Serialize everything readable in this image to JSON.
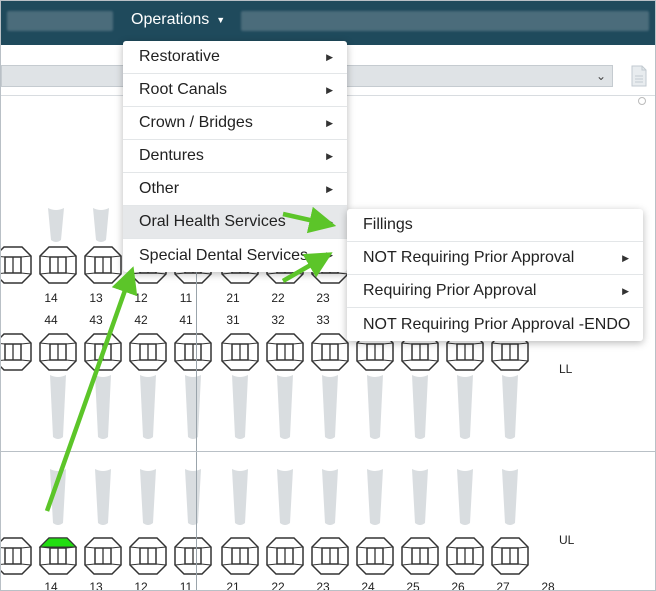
{
  "header": {
    "menu_label": "Operations",
    "menu_caret": "▼"
  },
  "dropdown": {
    "items": [
      {
        "label": "Restorative",
        "arrow": "▶"
      },
      {
        "label": "Root Canals",
        "arrow": "▶"
      },
      {
        "label": "Crown / Bridges",
        "arrow": "▶"
      },
      {
        "label": "Dentures",
        "arrow": "▶"
      },
      {
        "label": "Other",
        "arrow": "▶"
      },
      {
        "label": "Oral Health Services",
        "arrow": "▶"
      },
      {
        "label": "Special Dental Services",
        "arrow": "▶"
      }
    ],
    "active_index": 5
  },
  "submenu": {
    "items": [
      {
        "label": "Fillings",
        "arrow": ""
      },
      {
        "label": "NOT Requiring Prior Approval",
        "arrow": "▶"
      },
      {
        "label": "Requiring Prior Approval",
        "arrow": "▶"
      },
      {
        "label": "NOT Requiring Prior Approval -ENDO",
        "arrow": ""
      }
    ]
  },
  "toolbar": {
    "select_arrow": "⌄"
  },
  "chart": {
    "upper_numbers": [
      "14",
      "13",
      "12",
      "11",
      "21",
      "22",
      "23"
    ],
    "lower_numbers": [
      "44",
      "43",
      "42",
      "41",
      "31",
      "32",
      "33"
    ],
    "bottom_numbers": [
      "14",
      "13",
      "12",
      "11",
      "21",
      "22",
      "23",
      "24",
      "25",
      "26",
      "27",
      "28"
    ],
    "quadrant_labels": {
      "ll": "LL",
      "ul": "UL"
    },
    "highlight_color": "#22dd11",
    "annotation_color": "#5cc529"
  },
  "colors": {
    "header_bg": "#1f4a5c",
    "accent_green": "#5cc529"
  }
}
